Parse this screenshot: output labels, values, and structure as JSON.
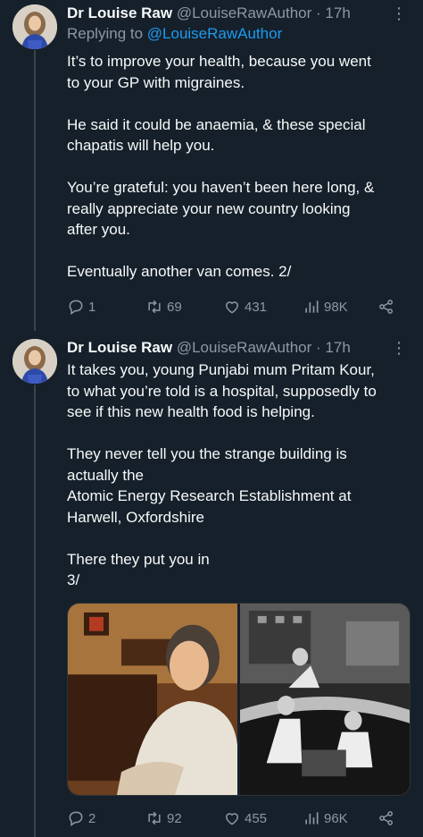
{
  "tweets": [
    {
      "name": "Dr Louise Raw",
      "handle": "@LouiseRawAuthor",
      "dot": "·",
      "time": "17h",
      "more": "⋮",
      "replying_prefix": "Replying to ",
      "replying_handle": "@LouiseRawAuthor",
      "lines": [
        "It’s to improve your health, because you went",
        "to your GP with migraines.",
        "",
        "He said it could be anaemia, & these special",
        "chapatis will help you.",
        "",
        "You’re grateful: you haven’t been here long, &",
        "really appreciate your new country looking",
        "after you.",
        "",
        "Eventually another van comes. 2/"
      ],
      "stats": {
        "replies": "1",
        "retweets": "69",
        "likes": "431",
        "views": "98K"
      }
    },
    {
      "name": "Dr Louise Raw",
      "handle": "@LouiseRawAuthor",
      "dot": "·",
      "time": "17h",
      "more": "⋮",
      "lines": [
        "It takes you, young Punjabi mum Pritam Kour,",
        "to what you’re told is a hospital, supposedly to",
        "see if this new health food is helping.",
        "",
        "They never tell you the strange building is",
        "actually the",
        "Atomic Energy Research Establishment at",
        "Harwell, Oxfordshire",
        "",
        "There they put you in",
        "3/"
      ],
      "stats": {
        "replies": "2",
        "retweets": "92",
        "likes": "455",
        "views": "96K"
      }
    }
  ],
  "colors": {
    "background": "#15202b",
    "text": "#f7f9f9",
    "muted": "#8b98a5",
    "link": "#1d9bf0",
    "thread": "#38444d"
  },
  "icons": [
    "reply-icon",
    "retweet-icon",
    "like-icon",
    "views-icon",
    "share-icon",
    "more-icon"
  ]
}
